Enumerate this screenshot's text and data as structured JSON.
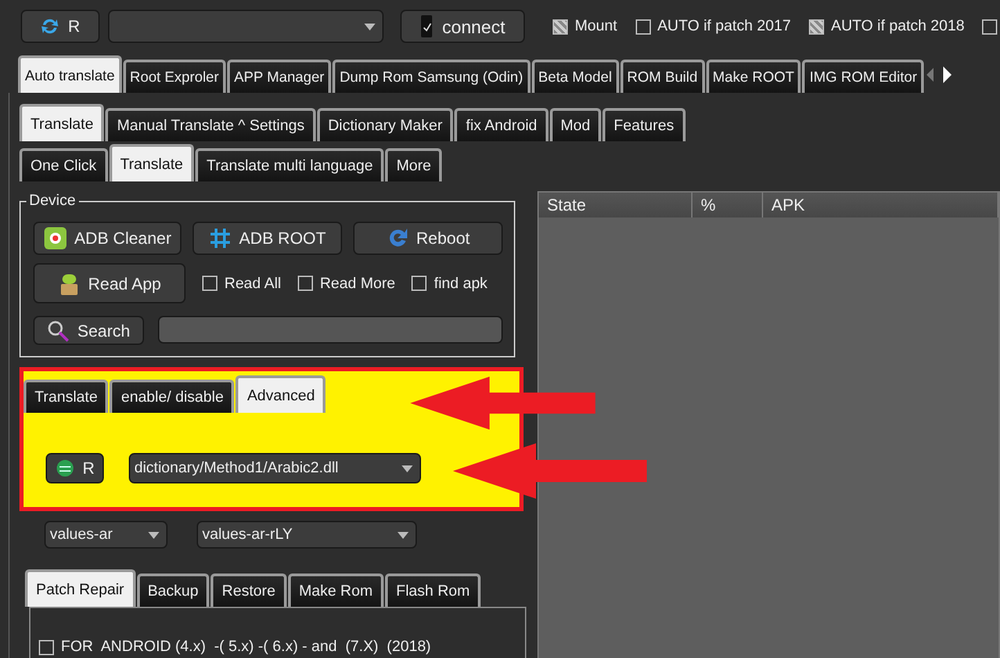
{
  "toolbar": {
    "refresh_button": {
      "label": "R"
    },
    "connect_button": {
      "label": "connect"
    },
    "options": [
      {
        "label": "Mount",
        "checked": true
      },
      {
        "label": "AUTO if patch 2017",
        "checked": false
      },
      {
        "label": "AUTO if patch 2018",
        "checked": true
      },
      {
        "checked": false
      }
    ]
  },
  "main_tabs": [
    {
      "label": "Auto translate",
      "selected": true
    },
    {
      "label": "Root Exproler",
      "selected": false
    },
    {
      "label": "APP Manager",
      "selected": false
    },
    {
      "label": "Dump Rom Samsung (Odin)",
      "selected": false
    },
    {
      "label": "Beta Model",
      "selected": false
    },
    {
      "label": "ROM Build",
      "selected": false
    },
    {
      "label": "Make ROOT",
      "selected": false
    },
    {
      "label": "IMG ROM Editor",
      "selected": false
    }
  ],
  "sub_tabs": [
    {
      "label": "Translate",
      "selected": true
    },
    {
      "label": "Manual Translate ^ Settings",
      "selected": false
    },
    {
      "label": "Dictionary Maker",
      "selected": false
    },
    {
      "label": "fix Android",
      "selected": false
    },
    {
      "label": "Mod",
      "selected": false
    },
    {
      "label": "Features",
      "selected": false
    }
  ],
  "mode_tabs": [
    {
      "label": "One Click",
      "selected": false
    },
    {
      "label": "Translate",
      "selected": true
    },
    {
      "label": "Translate multi language",
      "selected": false
    },
    {
      "label": "More",
      "selected": false
    }
  ],
  "device": {
    "title": "Device",
    "buttons": [
      {
        "label": "ADB Cleaner"
      },
      {
        "label": "ADB ROOT"
      },
      {
        "label": "Reboot"
      }
    ],
    "read_app_button": {
      "label": "Read App"
    },
    "options": [
      {
        "label": "Read All",
        "checked": false
      },
      {
        "label": "Read More",
        "checked": false
      },
      {
        "label": "find apk",
        "checked": false
      }
    ],
    "search_button": {
      "label": "Search"
    }
  },
  "advanced": {
    "tabs": [
      {
        "label": "Translate",
        "selected": false
      },
      {
        "label": "enable/ disable",
        "selected": false
      },
      {
        "label": "Advanced",
        "selected": true
      }
    ],
    "refresh_button": {
      "label": "R"
    },
    "dictionary_combo": {
      "value": "dictionary/Method1/Arabic2.dll"
    }
  },
  "locale_combos": [
    {
      "value": "values-ar"
    },
    {
      "value": "values-ar-rLY"
    }
  ],
  "bottom_tabs": [
    {
      "label": "Patch Repair",
      "selected": true
    },
    {
      "label": "Backup",
      "selected": false
    },
    {
      "label": "Restore",
      "selected": false
    },
    {
      "label": "Make Rom",
      "selected": false
    },
    {
      "label": "Flash Rom",
      "selected": false
    }
  ],
  "patch_options": [
    {
      "label": "FOR  ANDROID (4.x)  -( 5.x) -( 6.x) - and  (7.X)  (2018)",
      "checked": false
    }
  ],
  "table": {
    "columns": [
      "State",
      "%",
      "APK"
    ]
  }
}
